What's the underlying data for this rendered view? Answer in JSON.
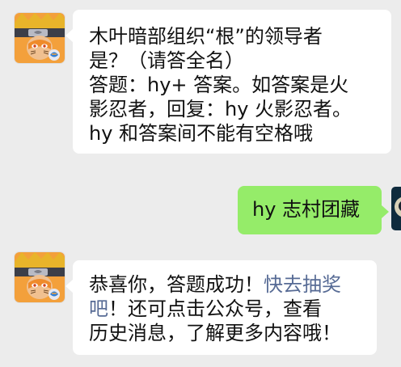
{
  "conversation": {
    "message_1": {
      "lines": [
        "木叶暗部组织“根”的领导者",
        "是？（请答全名）",
        "答题：hy+ 答案。如答案是火",
        "影忍者，回复：hy 火影忍者。",
        "hy 和答案间不能有空格哦"
      ]
    },
    "message_2": {
      "text": "hy 志村团藏"
    },
    "message_3": {
      "line_1_before": "恭喜你，答题成功！",
      "line_1_link": "快去抽奖",
      "line_2_link": "吧",
      "line_2_after": "！还可点击公众号，查看",
      "line_3": "历史消息，了解更多内容哦！"
    }
  },
  "colors": {
    "background": "#ececec",
    "incoming_bubble": "#ffffff",
    "outgoing_bubble": "#95ec69",
    "link": "#576b95"
  },
  "icons": {
    "sender_avatar": "naruto-avatar-icon",
    "user_avatar": "user-avatar-icon"
  }
}
